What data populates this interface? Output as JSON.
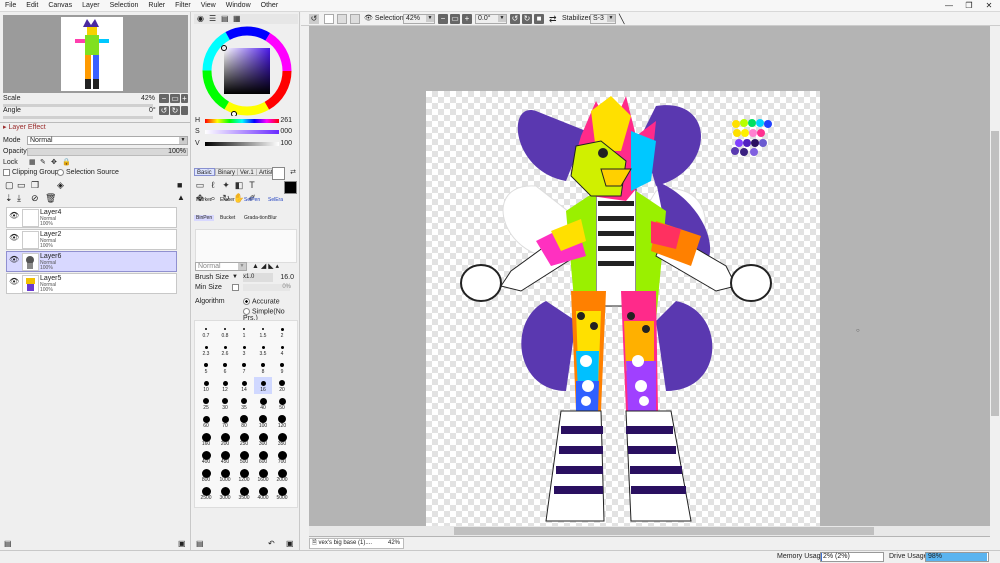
{
  "menu": [
    "File",
    "Edit",
    "Canvas",
    "Layer",
    "Selection",
    "Ruler",
    "Filter",
    "View",
    "Window",
    "Other"
  ],
  "window_controls": {
    "minimize": "—",
    "restore": "❐",
    "close": "✕"
  },
  "navigator": {
    "scale_label": "Scale",
    "scale_value": "42%",
    "angle_label": "Angle",
    "angle_value": "0°",
    "zoom_out": "−",
    "zoom_reset": "▭",
    "zoom_in": "+",
    "rot_left": "↺",
    "rot_right": "↻"
  },
  "layer_panel": {
    "effect_header": "Layer Effect",
    "mode_label": "Mode",
    "mode_value": "Normal",
    "opacity_label": "Opacity",
    "opacity_value": "100%",
    "lock_label": "Lock",
    "clipping_group": "Clipping Group",
    "selection_source": "Selection Source",
    "layers": [
      {
        "name": "Layer4",
        "mode": "Normal",
        "opacity": "100%",
        "selected": false
      },
      {
        "name": "Layer2",
        "mode": "Normal",
        "opacity": "100%",
        "selected": false
      },
      {
        "name": "Layer6",
        "mode": "Normal",
        "opacity": "100%",
        "selected": true
      },
      {
        "name": "Layer5",
        "mode": "Normal",
        "opacity": "100%",
        "selected": false
      }
    ]
  },
  "color": {
    "h_label": "H",
    "h_value": "261",
    "s_label": "S",
    "s_value": "000",
    "v_label": "V",
    "v_value": "100",
    "main_color": "#1b0f38",
    "fg_color": "#ffffff",
    "bg_color": "#000000"
  },
  "tool_tabs": [
    "Basic",
    "Binary",
    "Ver.1",
    "Artistic"
  ],
  "brushes": {
    "row1": [
      "Marker",
      "Eraser",
      "SelPen",
      "SelEra"
    ],
    "row2": [
      "BinPen",
      "Bucket",
      "Grada-tion",
      "Blur"
    ]
  },
  "brush_settings": {
    "mode": "Normal",
    "brush_size_label": "Brush Size",
    "brush_size_mult": "x1.0",
    "brush_size_value": "16.0",
    "min_size_label": "Min Size",
    "min_size_value": "0%",
    "algorithm_label": "Algorithm",
    "accurate": "Accurate",
    "simple": "Simple(No Prs.)"
  },
  "dot_sizes": [
    "0.7",
    "0.8",
    "1",
    "1.5",
    "2",
    "2.3",
    "2.6",
    "3",
    "3.5",
    "4",
    "5",
    "6",
    "7",
    "8",
    "9",
    "10",
    "12",
    "14",
    "16",
    "20",
    "25",
    "30",
    "35",
    "40",
    "50",
    "60",
    "70",
    "80",
    "100",
    "120",
    "160",
    "200",
    "250",
    "300",
    "350",
    "400",
    "450",
    "500",
    "600",
    "700",
    "800",
    "1000",
    "1200",
    "1600",
    "2000",
    "2500",
    "3000",
    "3500",
    "4000",
    "5000"
  ],
  "toolbar": {
    "selection_label": "Selection",
    "zoom": "42%",
    "angle": "0.0°",
    "stabilizer_label": "Stabilizer",
    "stabilizer_value": "S-3"
  },
  "tabs": [
    {
      "name": "vex's big base (1)....",
      "zoom": "42%"
    }
  ],
  "status": {
    "memory_label": "Memory Usage",
    "memory_value": "2% (2%)",
    "memory_fraction": 0.02,
    "drive_label": "Drive Usage",
    "drive_value": "98%",
    "drive_fraction": 0.98
  },
  "accent": "#3b6fd4"
}
